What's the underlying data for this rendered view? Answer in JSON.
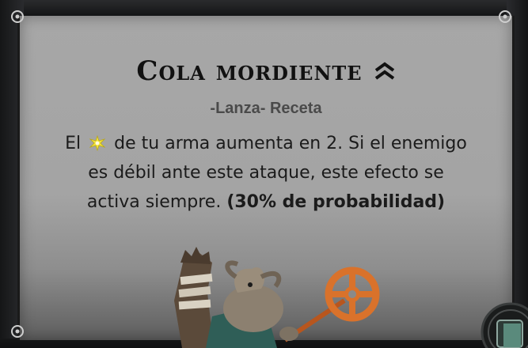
{
  "card": {
    "title": "Cola mordiente",
    "rank_icon": "double-chevron-up-icon",
    "subtitle": "-Lanza- Receta",
    "description": {
      "line1_before_icon": "El",
      "stat_icon": "spark-star-icon",
      "line1_after_icon": "de tu arma aumenta en 2. Si el enemigo",
      "line2": "es débil ante este ataque, este efecto se",
      "line3_text": "activa siempre.",
      "line3_bold": "(30% de probabilidad)"
    },
    "illustration": "horned-creature-with-key-staff",
    "corner_badge": "menu-corner-badge-icon"
  },
  "colors": {
    "card_background": "#a5a5a5",
    "title_text": "#111111",
    "subtitle_text": "#4a4a4a",
    "stat_icon_yellow": "#f2e23a",
    "staff_orange": "#d9722b"
  }
}
